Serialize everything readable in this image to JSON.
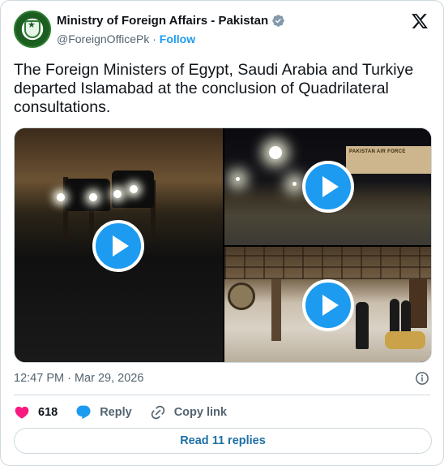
{
  "account": {
    "name": "Ministry of Foreign Affairs - Pakistan",
    "handle": "@ForeignOfficePk",
    "separator": "·",
    "follow_label": "Follow"
  },
  "tweet": {
    "text": "The Foreign Ministers of Egypt, Saudi Arabia and Turkiye departed Islamabad at the conclusion of Quadrilateral consultations.",
    "timestamp": "12:47 PM · Mar 29, 2026"
  },
  "media": {
    "videos": [
      {
        "label": "video-motorcade"
      },
      {
        "label": "video-airport"
      },
      {
        "label": "video-terminal"
      }
    ],
    "airport_sign": "PAKISTAN AIR FORCE"
  },
  "actions": {
    "likes": "618",
    "reply_label": "Reply",
    "copy_label": "Copy link"
  },
  "read_replies_label": "Read 11 replies",
  "icons": [
    "verified-badge-icon",
    "x-logo-icon",
    "play-icon",
    "info-icon",
    "heart-icon",
    "reply-icon",
    "link-icon"
  ],
  "colors": {
    "accent": "#1d9bf0",
    "like": "#f91880",
    "text_secondary": "#536471",
    "border": "#cfd9de"
  }
}
